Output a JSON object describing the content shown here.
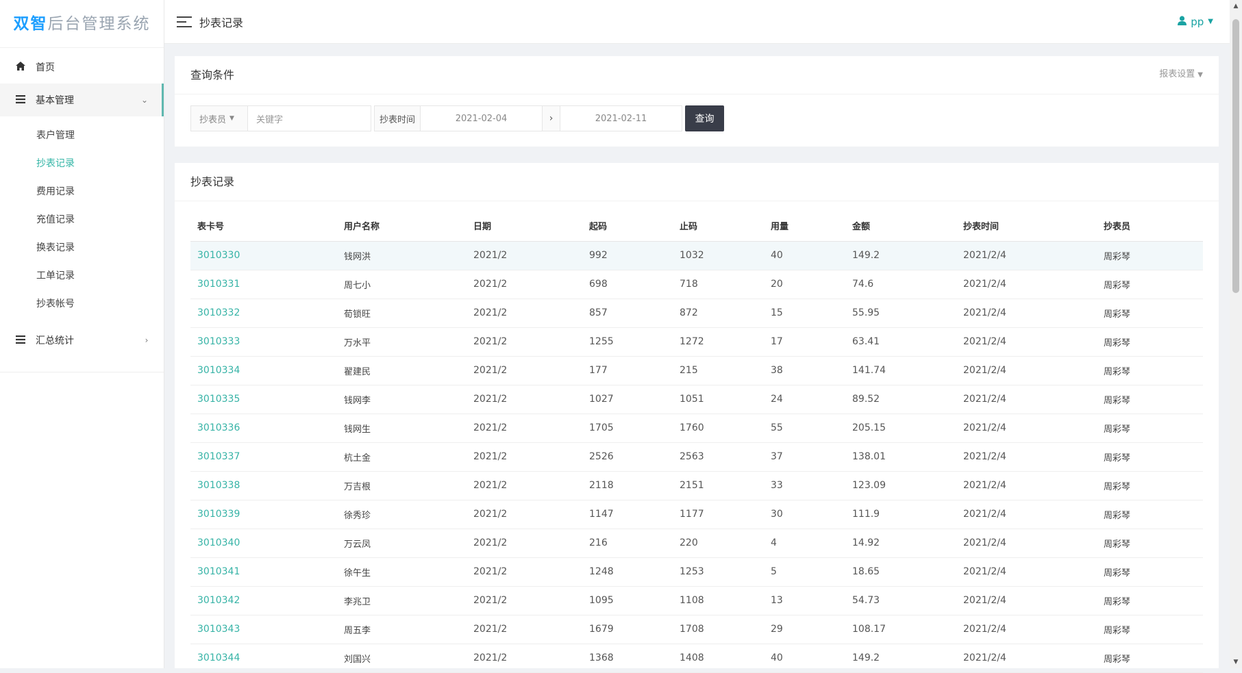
{
  "app": {
    "logo_brand": "双智",
    "logo_rest": "后台管理系统"
  },
  "sidebar": {
    "home": "首页",
    "basic_group": "基本管理",
    "sub_items": [
      "表户管理",
      "抄表记录",
      "费用记录",
      "充值记录",
      "换表记录",
      "工单记录",
      "抄表帐号"
    ],
    "current_sub": "抄表记录",
    "stats_group": "汇总统计"
  },
  "header": {
    "title": "抄表记录",
    "user": "pp"
  },
  "query": {
    "title": "查询条件",
    "report_settings": "报表设置",
    "reader_select": "抄表员",
    "keyword_placeholder": "关键字",
    "time_label": "抄表时间",
    "date_start": "2021-02-04",
    "date_sep": "›",
    "date_end": "2021-02-11",
    "search_button": "查询"
  },
  "records": {
    "title": "抄表记录",
    "columns": [
      "表卡号",
      "用户名称",
      "日期",
      "起码",
      "止码",
      "用量",
      "金额",
      "抄表时间",
      "抄表员"
    ],
    "rows": [
      [
        "3010330",
        "钱网洪",
        "2021/2",
        "992",
        "1032",
        "40",
        "149.2",
        "2021/2/4",
        "周彩琴"
      ],
      [
        "3010331",
        "周七小",
        "2021/2",
        "698",
        "718",
        "20",
        "74.6",
        "2021/2/4",
        "周彩琴"
      ],
      [
        "3010332",
        "荀锁旺",
        "2021/2",
        "857",
        "872",
        "15",
        "55.95",
        "2021/2/4",
        "周彩琴"
      ],
      [
        "3010333",
        "万水平",
        "2021/2",
        "1255",
        "1272",
        "17",
        "63.41",
        "2021/2/4",
        "周彩琴"
      ],
      [
        "3010334",
        "翟建民",
        "2021/2",
        "177",
        "215",
        "38",
        "141.74",
        "2021/2/4",
        "周彩琴"
      ],
      [
        "3010335",
        "钱网李",
        "2021/2",
        "1027",
        "1051",
        "24",
        "89.52",
        "2021/2/4",
        "周彩琴"
      ],
      [
        "3010336",
        "钱网生",
        "2021/2",
        "1705",
        "1760",
        "55",
        "205.15",
        "2021/2/4",
        "周彩琴"
      ],
      [
        "3010337",
        "杭土金",
        "2021/2",
        "2526",
        "2563",
        "37",
        "138.01",
        "2021/2/4",
        "周彩琴"
      ],
      [
        "3010338",
        "万吉根",
        "2021/2",
        "2118",
        "2151",
        "33",
        "123.09",
        "2021/2/4",
        "周彩琴"
      ],
      [
        "3010339",
        "徐秀珍",
        "2021/2",
        "1147",
        "1177",
        "30",
        "111.9",
        "2021/2/4",
        "周彩琴"
      ],
      [
        "3010340",
        "万云凤",
        "2021/2",
        "216",
        "220",
        "4",
        "14.92",
        "2021/2/4",
        "周彩琴"
      ],
      [
        "3010341",
        "徐午生",
        "2021/2",
        "1248",
        "1253",
        "5",
        "18.65",
        "2021/2/4",
        "周彩琴"
      ],
      [
        "3010342",
        "李兆卫",
        "2021/2",
        "1095",
        "1108",
        "13",
        "54.73",
        "2021/2/4",
        "周彩琴"
      ],
      [
        "3010343",
        "周五李",
        "2021/2",
        "1679",
        "1708",
        "29",
        "108.17",
        "2021/2/4",
        "周彩琴"
      ],
      [
        "3010344",
        "刘国兴",
        "2021/2",
        "1368",
        "1408",
        "40",
        "149.2",
        "2021/2/4",
        "周彩琴"
      ]
    ]
  },
  "colors": {
    "accent": "#36b3a6",
    "brand": "#1e9fff",
    "button_dark": "#393d49"
  }
}
